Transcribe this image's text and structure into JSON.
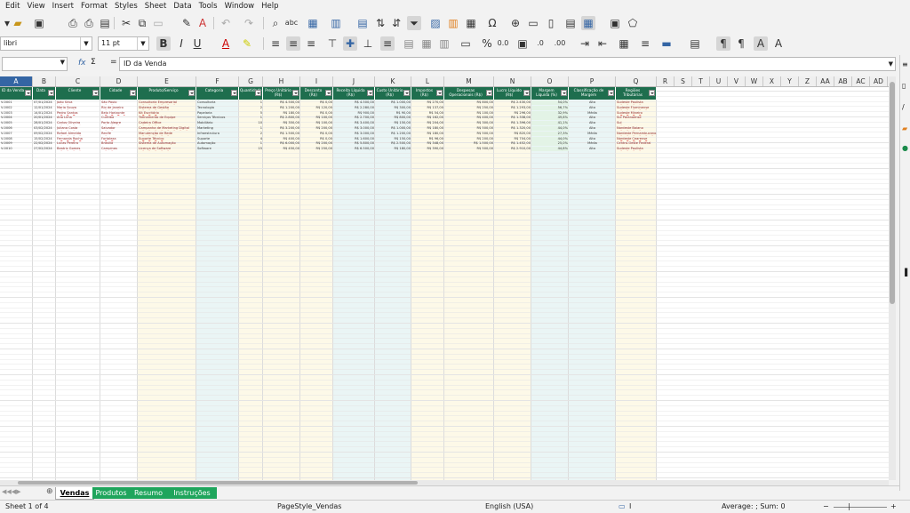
{
  "menu": [
    "Edit",
    "View",
    "Insert",
    "Format",
    "Styles",
    "Sheet",
    "Data",
    "Tools",
    "Window",
    "Help"
  ],
  "toolbar": {
    "font_name": "libri",
    "font_size": "11 pt"
  },
  "formula_bar": {
    "name_box": "",
    "fx_label": "fx",
    "sum_label": "Σ",
    "eq_label": "=",
    "content": "ID da Venda"
  },
  "columns": [
    "A",
    "B",
    "C",
    "D",
    "E",
    "F",
    "G",
    "H",
    "I",
    "J",
    "K",
    "L",
    "M",
    "N",
    "O",
    "P",
    "Q",
    "R",
    "S",
    "T",
    "U",
    "V",
    "W",
    "X",
    "Y",
    "Z",
    "AA",
    "AB",
    "AC",
    "AD"
  ],
  "selected_column": "A",
  "headers": [
    "ID da Venda",
    "Data",
    "Cliente",
    "Cidade",
    "Produto/Serviço",
    "Categoria",
    "Quantidade",
    "Preço Unitário (R$)",
    "Desconto (R$)",
    "Receita Líquida (R$)",
    "Custo Unitário (R$)",
    "Impostos (R$)",
    "Despesas Operacionais (R$)",
    "Lucro Líquido (R$)",
    "Margem Líquida (%)",
    "Classificação de Margem",
    "Regiões Tributárias"
  ],
  "rows": [
    [
      "V-0001",
      "07/01/2024",
      "João Silva",
      "São Paulo",
      "Consultoria Empresarial",
      "Consultoria",
      "1",
      "R$ 4.500,00",
      "R$ 0,00",
      "R$ 4.500,00",
      "R$ 1.000,00",
      "R$ 270,00",
      "R$ 800,00",
      "R$ 2.430,00",
      "54,0%",
      "Alta",
      "Sudeste Paulista"
    ],
    [
      "V-0002",
      "12/01/2024",
      "Maria Souza",
      "Rio de Janeiro",
      "Sistema de Gestão",
      "Tecnologia",
      "2",
      "R$ 1.200,00",
      "R$ 120,00",
      "R$ 2.280,00",
      "R$ 300,00",
      "R$ 137,00",
      "R$ 250,00",
      "R$ 1.293,00",
      "56,7%",
      "Alta",
      "Sudeste Fluminense"
    ],
    [
      "V-0003",
      "14/01/2024",
      "Pedro Santos",
      "Belo Horizonte",
      "Kit Escritório",
      "Papelaria",
      "5",
      "R$ 180,00",
      "R$ 0,00",
      "R$ 900,00",
      "R$ 90,00",
      "R$ 54,00",
      "R$ 100,00",
      "R$ 296,00",
      "32,9%",
      "Média",
      "Sudeste Mineiro"
    ],
    [
      "V-0004",
      "20/01/2024",
      "Ana Lima",
      "Curitiba",
      "Treinamento de Equipe",
      "Serviços Técnicos",
      "1",
      "R$ 2.800,00",
      "R$ 100,00",
      "R$ 2.700,00",
      "R$ 800,00",
      "R$ 162,00",
      "R$ 400,00",
      "R$ 1.338,00",
      "49,6%",
      "Alta",
      "Sul Paranaense"
    ],
    [
      "V-0005",
      "28/01/2024",
      "Carlos Oliveira",
      "Porto Alegre",
      "Cadeira Office",
      "Mobiliário",
      "10",
      "R$ 350,00",
      "R$ 100,00",
      "R$ 3.400,00",
      "R$ 150,00",
      "R$ 204,00",
      "R$ 300,00",
      "R$ 1.396,00",
      "41,1%",
      "Alta",
      "Sul"
    ],
    [
      "V-0006",
      "03/02/2024",
      "Juliana Costa",
      "Salvador",
      "Campanha de Marketing Digital",
      "Marketing",
      "1",
      "R$ 3.200,00",
      "R$ 200,00",
      "R$ 3.000,00",
      "R$ 1.000,00",
      "R$ 180,00",
      "R$ 500,00",
      "R$ 1.320,00",
      "44,0%",
      "Alta",
      "Nordeste Baiano"
    ],
    [
      "V-0007",
      "09/02/2024",
      "Rafael Almeida",
      "Recife",
      "Manutenção de Rede",
      "Infraestrutura",
      "2",
      "R$ 1.500,00",
      "R$ 0,00",
      "R$ 3.000,00",
      "R$ 1.200,00",
      "R$ 180,00",
      "R$ 500,00",
      "R$ 820,00",
      "27,3%",
      "Média",
      "Nordeste Pernambucano"
    ],
    [
      "V-0008",
      "15/02/2024",
      "Fernanda Rocha",
      "Fortaleza",
      "Suporte Técnico",
      "Suporte",
      "4",
      "R$ 400,00",
      "R$ 0,00",
      "R$ 1.600,00",
      "R$ 150,00",
      "R$ 96,00",
      "R$ 200,00",
      "R$ 704,00",
      "44,0%",
      "Alta",
      "Nordeste Cearense"
    ],
    [
      "V-0009",
      "22/02/2024",
      "Lucas Pereira",
      "Brasília",
      "Sistema de Automação",
      "Automação",
      "1",
      "R$ 6.000,00",
      "R$ 200,00",
      "R$ 5.800,00",
      "R$ 2.500,00",
      "R$ 348,00",
      "R$ 1.500,00",
      "R$ 1.452,00",
      "25,0%",
      "Média",
      "Centro-Oeste Federal"
    ],
    [
      "V-0010",
      "27/02/2024",
      "Beatriz Gomes",
      "Campinas",
      "Licença de Software",
      "Software",
      "15",
      "R$ 450,00",
      "R$ 250,00",
      "R$ 6.500,00",
      "R$ 180,00",
      "R$ 390,00",
      "R$ 500,00",
      "R$ 2.910,00",
      "44,8%",
      "Alta",
      "Sudeste Paulista"
    ]
  ],
  "sheet_tabs": [
    {
      "label": "Vendas",
      "active": true
    },
    {
      "label": "Produtos",
      "active": false
    },
    {
      "label": "Resumo",
      "active": false
    },
    {
      "label": "Instruções",
      "active": false
    }
  ],
  "status": {
    "sheet_info": "Sheet 1 of 4",
    "page_style": "PageStyle_Vendas",
    "language": "English (USA)",
    "summary": "Average: ; Sum: 0"
  },
  "colors": {
    "header_green": "#1e6e4e",
    "tab_green": "#1fa55c",
    "selected_blue": "#3465a4"
  }
}
